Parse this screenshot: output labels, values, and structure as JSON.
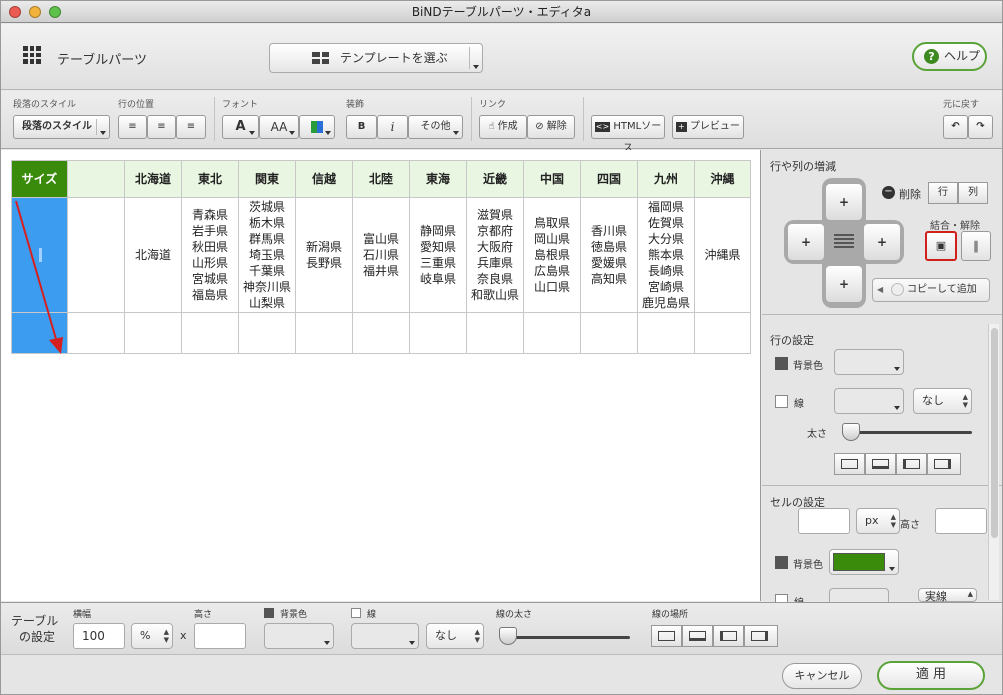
{
  "window": {
    "title": "BiNDテーブルパーツ・エディタa"
  },
  "header": {
    "title": "テーブルパーツ",
    "template_select": "テンプレートを選ぶ",
    "help": "ヘルプ",
    "help_glyph": "?"
  },
  "toolbar": {
    "para_style_label": "段落のスタイル",
    "para_style_value": "段落のスタイル",
    "row_pos_label": "行の位置",
    "font_label": "フォント",
    "font_a": "A",
    "font_aa": "AA",
    "deco_label": "装飾",
    "bold": "B",
    "italic": "i",
    "other": "その他",
    "link_label": "リンク",
    "create": "作成",
    "remove": "解除",
    "html_source": "HTMLソース",
    "preview": "プレビュー",
    "undo_label": "元に戻す"
  },
  "table": {
    "header": [
      "サイズ",
      "",
      "北海道",
      "東北",
      "関東",
      "信越",
      "北陸",
      "東海",
      "近畿",
      "中国",
      "四国",
      "九州",
      "沖縄"
    ],
    "body": [
      "",
      "",
      "北海道",
      "青森県\n岩手県\n秋田県\n山形県\n宮城県\n福島県",
      "茨城県\n栃木県\n群馬県\n埼玉県\n千葉県\n神奈川県\n山梨県",
      "新潟県\n長野県",
      "富山県\n石川県\n福井県",
      "静岡県\n愛知県\n三重県\n岐阜県",
      "滋賀県\n京都府\n大阪府\n兵庫県\n奈良県\n和歌山県",
      "鳥取県\n岡山県\n島根県\n広島県\n山口県",
      "香川県\n徳島県\n愛媛県\n高知県",
      "福岡県\n佐賀県\n大分県\n熊本県\n長崎県\n宮崎県\n鹿児島県",
      "沖縄県"
    ]
  },
  "rowcol": {
    "title": "行や列の増減",
    "delete": "削除",
    "row": "行",
    "col": "列",
    "merge": "結合・解除",
    "copy_add": "コピーして追加"
  },
  "row_settings": {
    "title": "行の設定",
    "bg": "背景色",
    "line": "線",
    "line_style": "なし",
    "thickness": "太さ"
  },
  "cell_settings": {
    "title": "セルの設定",
    "unit": "px",
    "height": "高さ",
    "bg": "背景色",
    "bg_color": "#3a8a0c",
    "line": "線",
    "line_style": "実線"
  },
  "table_settings": {
    "title1": "テーブル",
    "title2": "の設定",
    "width_label": "横幅",
    "width_value": "100",
    "unit": "%",
    "x": "x",
    "height_label": "高さ",
    "bg": "背景色",
    "line": "線",
    "line_style": "なし",
    "thickness": "線の太さ",
    "position": "線の場所"
  },
  "footer": {
    "cancel": "キャンセル",
    "apply": "適 用"
  }
}
